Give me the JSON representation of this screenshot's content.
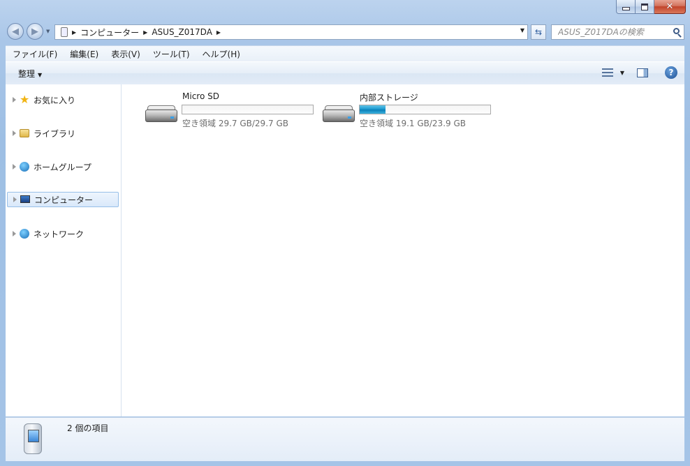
{
  "window": {
    "caption": {
      "minimize": "minimize",
      "maximize": "maximize",
      "close": "✕"
    }
  },
  "navigation": {
    "address_crumbs": [
      "コンピューター",
      "ASUS_Z017DA"
    ],
    "search_placeholder": "ASUS_Z017DAの検索"
  },
  "menubar": {
    "items": [
      "ファイル(F)",
      "編集(E)",
      "表示(V)",
      "ツール(T)",
      "ヘルプ(H)"
    ]
  },
  "toolbar": {
    "organize_label": "整理"
  },
  "nav_pane": {
    "items": [
      {
        "label": "お気に入り",
        "icon": "star-icon"
      },
      {
        "label": "ライブラリ",
        "icon": "library-icon"
      },
      {
        "label": "ホームグループ",
        "icon": "homegroup-icon"
      },
      {
        "label": "コンピューター",
        "icon": "computer-icon",
        "selected": true
      },
      {
        "label": "ネットワーク",
        "icon": "network-icon"
      }
    ]
  },
  "drives": [
    {
      "name": "Micro SD",
      "free_text": "空き領域 29.7 GB/29.7 GB",
      "used_fraction": 0.0
    },
    {
      "name": "内部ストレージ",
      "free_text": "空き領域 19.1 GB/23.9 GB",
      "used_fraction": 0.2
    }
  ],
  "details": {
    "item_count": "2 個の項目"
  },
  "colors": {
    "frame": "#a9c6e8",
    "selection": "#d9e8fa",
    "usage_bar": "#1e9ad0"
  }
}
